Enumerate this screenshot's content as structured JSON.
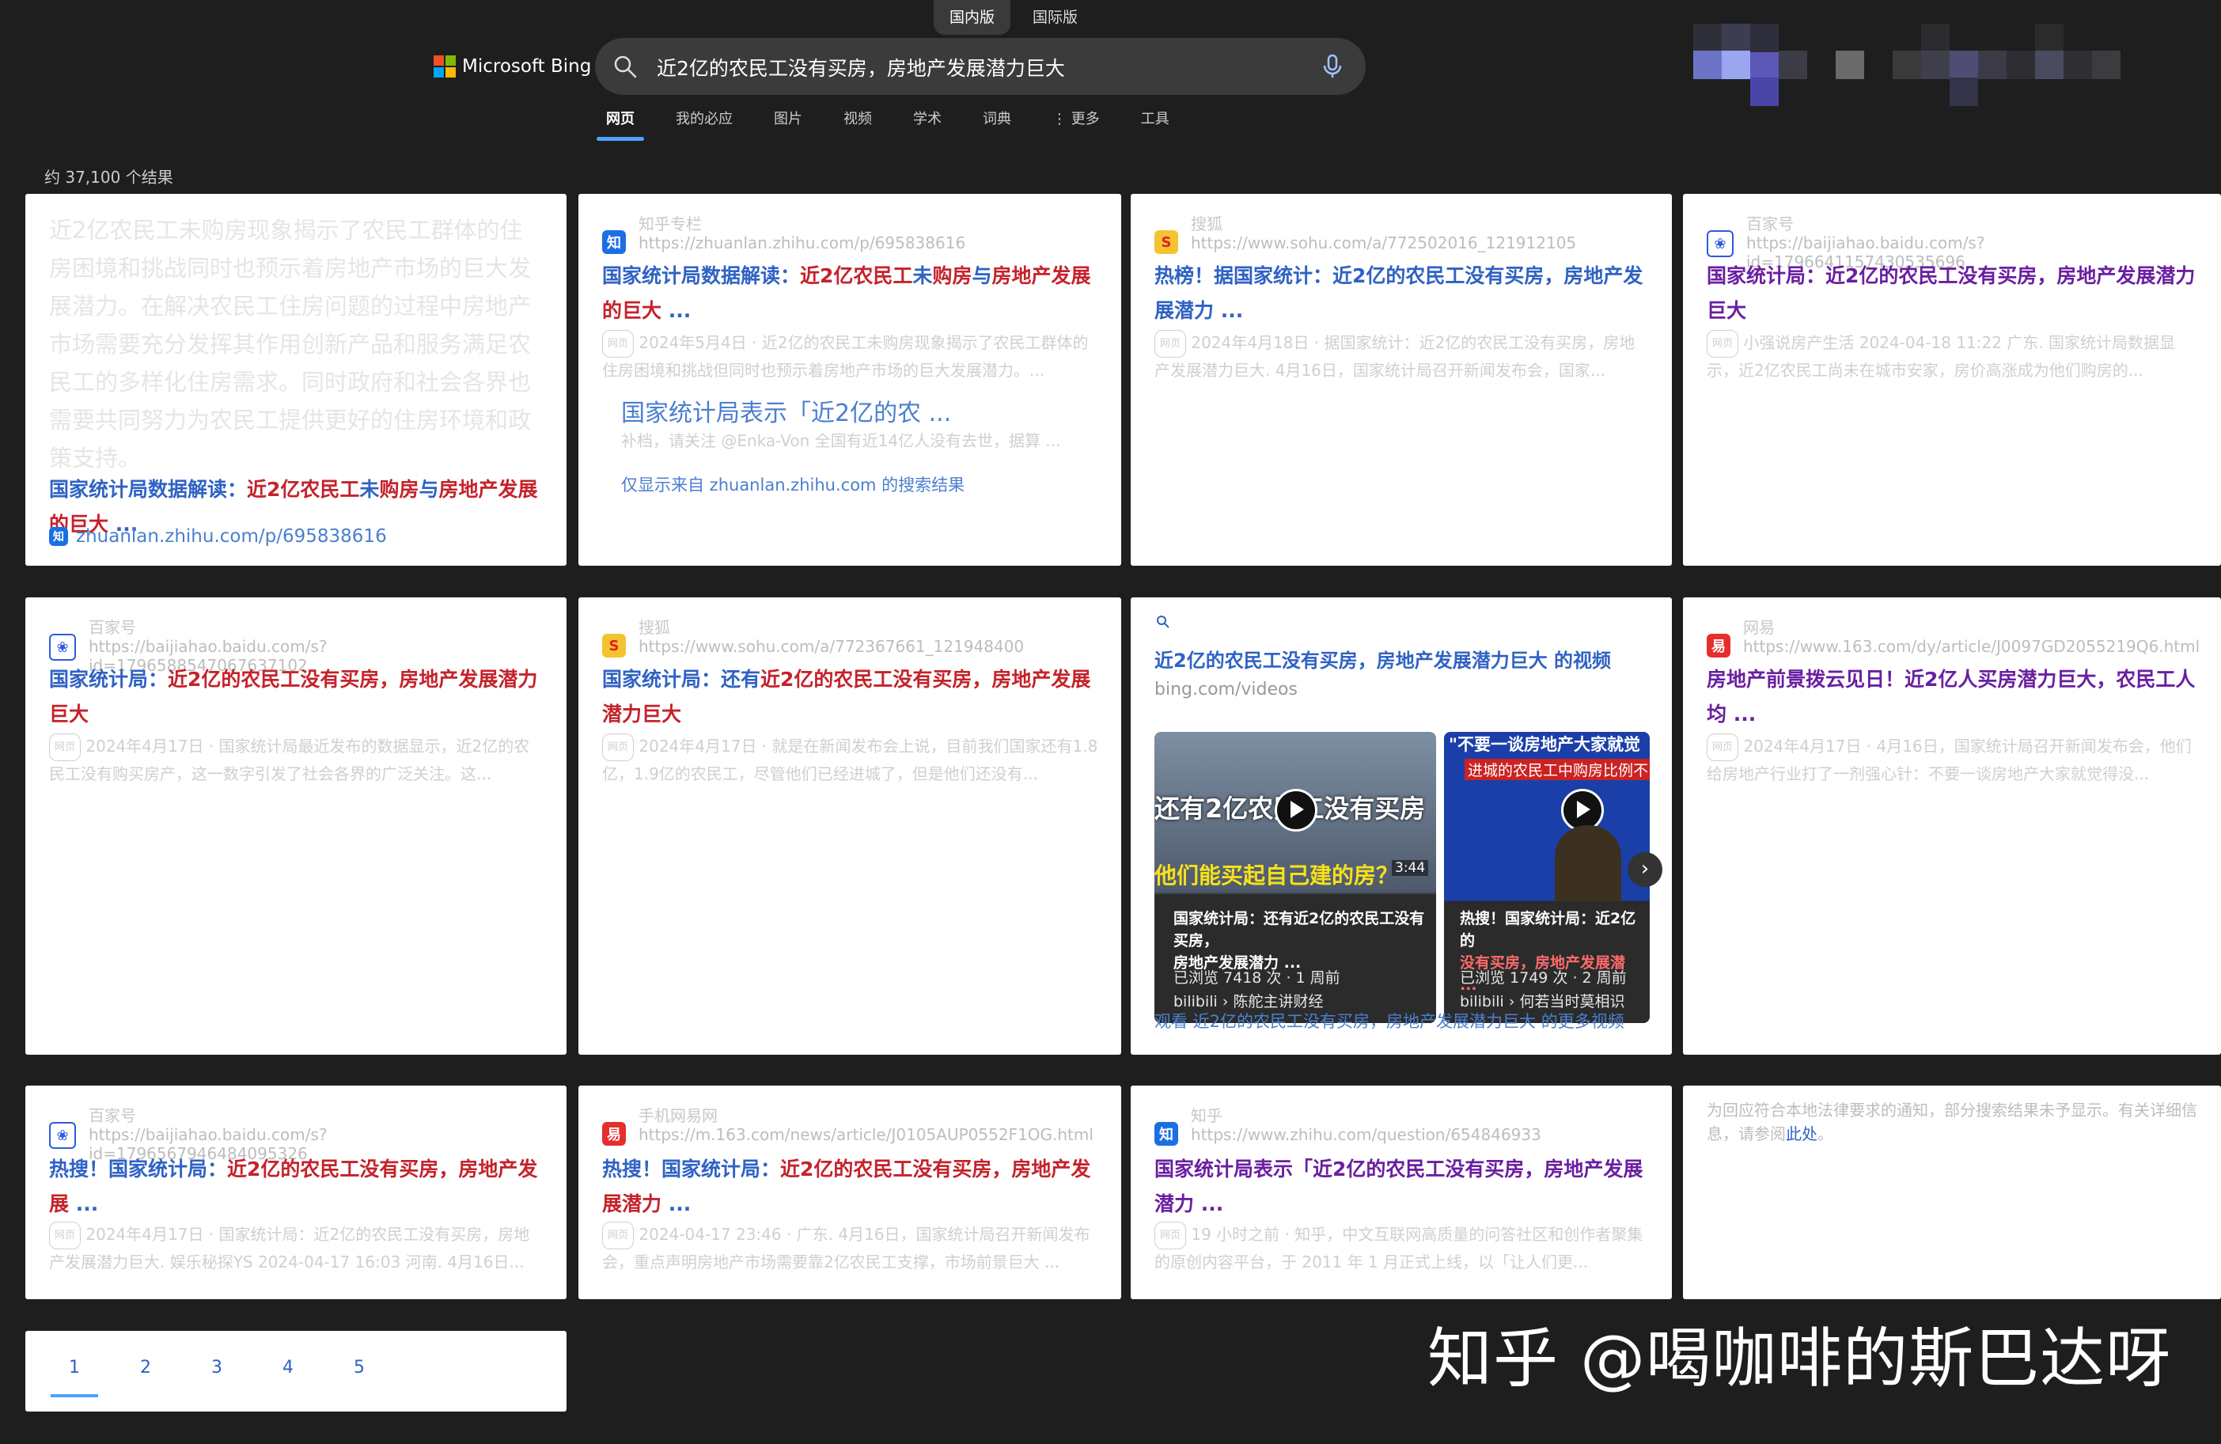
{
  "header": {
    "region_tabs": [
      "国内版",
      "国际版"
    ],
    "logo": "Microsoft Bing",
    "query": "近2亿的农民工没有买房，房地产发展潜力巨大",
    "nav": [
      "网页",
      "我的必应",
      "图片",
      "视频",
      "学术",
      "词典",
      "⋮ 更多",
      "工具"
    ]
  },
  "result_count": "约 37,100 个结果",
  "r1": {
    "text": "近2亿农民工未购房现象揭示了农民工群体的住房困境和挑战同时也预示着房地产市场的巨大发展潜力。在解决农民工住房问题的过程中房地产市场需要充分发挥其作用创新产品和服务满足农民工的多样化住房需求。同时政府和社会各界也需要共同努力为农民工提供更好的住房环境和政策支持。",
    "title_a": "国家统计局数据解读：",
    "title_b": "近2亿农民工",
    "title_c": "未",
    "title_d": "购房",
    "title_e": "与",
    "title_f": "房地产发展的巨大",
    "title_g": " ...",
    "url": "zhuanlan.zhihu.com/p/695838616"
  },
  "r2": {
    "site": "知乎专栏",
    "url": "https://zhuanlan.zhihu.com/p/695838616",
    "title_a": "国家统计局数据解读：",
    "title_b": "近2亿农民工",
    "title_c": "未",
    "title_d": "购房",
    "title_e": "与",
    "title_f": "房地产发展的巨大",
    "title_g": " ...",
    "snippet": "2024年5月4日 · 近2亿的农民工未购房现象揭示了农民工群体的住房困境和挑战但同时也预示着房地产市场的巨大发展潜力。...",
    "sub_title": "国家统计局表示「近2亿的农 ...",
    "sub_snippet": "补档，请关注 @Enka-Von 全国有近14亿人没有去世，据算 ...",
    "only_from": "仅显示来自 zhuanlan.zhihu.com 的搜索结果"
  },
  "r3": {
    "site": "搜狐",
    "url": "https://www.sohu.com/a/772502016_121912105",
    "title_a": "热榜！据国家统计：",
    "title_b": "近2亿的农民工没有买房，房地产发展潜力",
    "title_c": " ...",
    "snippet": "2024年4月18日 · 据国家统计：近2亿的农民工没有买房，房地产发展潜力巨大. 4月16日，国家统计局召开新闻发布会，国家..."
  },
  "r4": {
    "site": "百家号",
    "url": "https://baijiahao.baidu.com/s?id=1796641157430535696",
    "title": "国家统计局：近2亿的农民工没有买房，房地产发展潜力巨大",
    "snippet": "小强说房产生活 2024-04-18 11:22 广东. 国家统计局数据显示，近2亿农民工尚未在城市安家，房价高涨成为他们购房的..."
  },
  "r5": {
    "site": "百家号",
    "url": "https://baijiahao.baidu.com/s?id=1796588547067637102",
    "title_a": "国家统计局：",
    "title_b": "近2亿的农民工没有买房，房地产发展潜力巨大",
    "snippet": "2024年4月17日 · 国家统计局最近发布的数据显示，近2亿的农民工没有购买房产，这一数字引发了社会各界的广泛关注。这..."
  },
  "r6": {
    "site": "搜狐",
    "url": "https://www.sohu.com/a/772367661_121948400",
    "title_a": "国家统计局：还有",
    "title_b": "近2亿的农民工没有买房，房地产发展潜力巨大",
    "snippet": "2024年4月17日 · 就是在新闻发布会上说，目前我们国家还有1.8亿，1.9亿的农民工，尽管他们已经进城了，但是他们还没有..."
  },
  "r7": {
    "title": "近2亿的农民工没有买房，房地产发展潜力巨大 的视频",
    "site": "bing.com/videos",
    "v1_overlay_top": "还有2亿农民工没有买房",
    "v1_overlay_bottom": "他们能买起自己建的房？",
    "v1_duration": "3:44",
    "v1_title": "国家统计局：还有近2亿的农民工没有买房，",
    "v1_title2": "房地产发展潜力 ...",
    "v1_views": "已浏览 7418 次 · 1 周前",
    "v1_channel": "bilibili › 陈舵主讲财经",
    "v2_overlay_top": "\"不要一谈房地产大家就觉",
    "v2_overlay_mid": "进城的农民工中购房比例不",
    "v2_title": "热搜！国家统计局：近2亿的",
    "v2_title2": "没有买房，房地产发展潜 ...",
    "v2_views": "已浏览 1749 次 · 2 周前",
    "v2_channel": "bilibili › 何若当时莫相识",
    "more": "观看 近2亿的农民工没有买房，房地产发展潜力巨大 的更多视频"
  },
  "r8": {
    "site": "网易",
    "url": "https://www.163.com/dy/article/J0097GD2055219Q6.html",
    "title": "房地产前景拨云见日！近2亿人买房潜力巨大，农民工人均 ...",
    "snippet": "2024年4月17日 · 4月16日，国家统计局召开新闻发布会，他们给房地产行业打了一剂强心针：不要一谈房地产大家就觉得没..."
  },
  "r9": {
    "site": "百家号",
    "url": "https://baijiahao.baidu.com/s?id=1796567946484095326",
    "title_a": "热搜！国家统计局：",
    "title_b": "近2亿的农民工没有买房，房地产发展",
    "title_c": " ...",
    "snippet": "2024年4月17日 · 国家统计局：近2亿的农民工没有买房，房地产发展潜力巨大. 娱乐秘探YS 2024-04-17 16:03 河南. 4月16日..."
  },
  "r10": {
    "site": "手机网易网",
    "url": "https://m.163.com/news/article/J0105AUP0552F1OG.html",
    "title_a": "热搜！国家统计局：",
    "title_b": "近2亿的农民工没有买房，房地产发展潜力",
    "title_c": " ...",
    "snippet": "2024-04-17 23:46 · 广东. 4月16日，国家统计局召开新闻发布会，重点声明房地产市场需要靠2亿农民工支撑，市场前景巨大 ..."
  },
  "r11": {
    "site": "知乎",
    "url": "https://www.zhihu.com/question/654846933",
    "title": "国家统计局表示「近2亿的农民工没有买房，房地产发展潜力 ...",
    "snippet": "19 小时之前 · 知乎，中文互联网高质量的问答社区和创作者聚集的原创内容平台，于 2011 年 1 月正式上线，以「让人们更..."
  },
  "r12": {
    "notice": "为回应符合本地法律要求的通知，部分搜索结果未予显示。有关详细信息，请参阅",
    "link": "此处",
    "end": "。"
  },
  "pager": [
    "1",
    "2",
    "3",
    "4",
    "5"
  ],
  "watermark": "知乎 @喝咖啡的斯巴达呀",
  "colors": {
    "bg": "#1e1e1e",
    "link": "#2f62c4",
    "highlight": "#c5222b",
    "accent": "#4da3ff"
  }
}
